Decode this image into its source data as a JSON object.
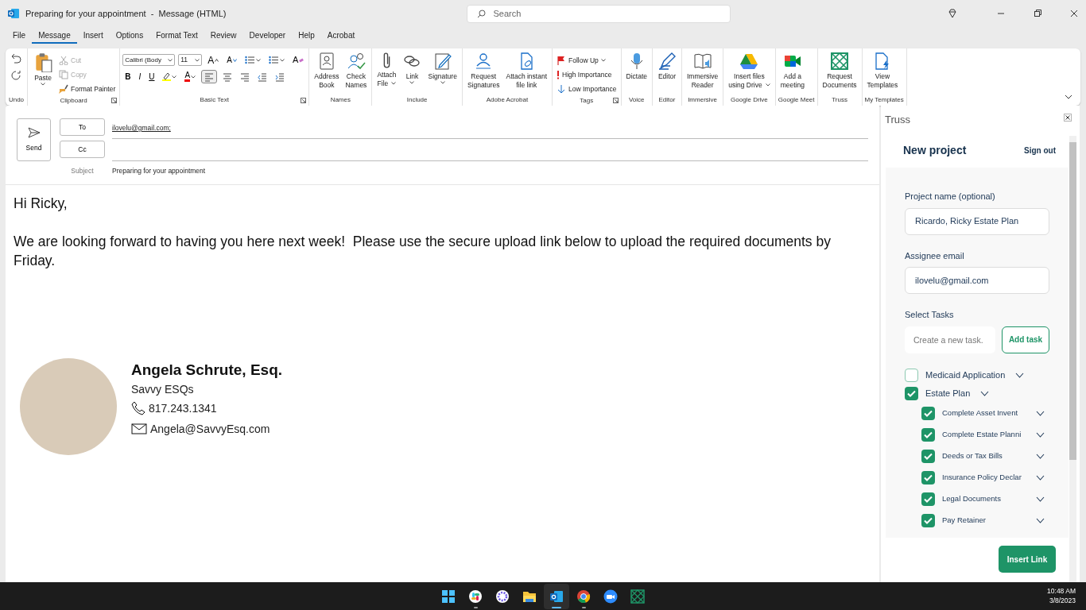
{
  "window": {
    "title": "Preparing for your appointment  -  Message (HTML)",
    "search_placeholder": "Search"
  },
  "menu_tabs": [
    {
      "label": "File",
      "selected": false
    },
    {
      "label": "Message",
      "selected": true
    },
    {
      "label": "Insert",
      "selected": false
    },
    {
      "label": "Options",
      "selected": false
    },
    {
      "label": "Format Text",
      "selected": false
    },
    {
      "label": "Review",
      "selected": false
    },
    {
      "label": "Developer",
      "selected": false
    },
    {
      "label": "Help",
      "selected": false
    },
    {
      "label": "Acrobat",
      "selected": false
    }
  ],
  "ribbon_groups": [
    {
      "label": "Undo",
      "launcher": false
    },
    {
      "label": "Clipboard",
      "launcher": true,
      "items": [
        {
          "kind": "large",
          "lines": [
            "Paste"
          ],
          "dropdown": true,
          "disabled": false
        },
        {
          "kind": "small",
          "lines": [
            "Cut"
          ],
          "dropdown": false,
          "disabled": true
        },
        {
          "kind": "small",
          "lines": [
            "Copy"
          ],
          "dropdown": false,
          "disabled": true
        },
        {
          "kind": "small",
          "lines": [
            "Format Painter"
          ],
          "dropdown": false,
          "disabled": false
        }
      ]
    },
    {
      "label": "Basic Text",
      "launcher": true,
      "items": [
        {
          "kind": "basic_text"
        }
      ]
    },
    {
      "label": "Names",
      "launcher": false,
      "items": [
        {
          "kind": "large",
          "lines": [
            "Address",
            "Book"
          ],
          "dropdown": false,
          "disabled": false
        },
        {
          "kind": "large",
          "lines": [
            "Check",
            "Names"
          ],
          "dropdown": false,
          "disabled": false
        }
      ]
    },
    {
      "label": "Include",
      "launcher": false,
      "items": [
        {
          "kind": "large",
          "lines": [
            "Attach",
            "File"
          ],
          "dropdown": true,
          "disabled": false
        },
        {
          "kind": "large",
          "lines": [
            "Link"
          ],
          "dropdown": true,
          "disabled": false
        },
        {
          "kind": "large",
          "lines": [
            "Signature"
          ],
          "dropdown": true,
          "disabled": false
        }
      ]
    },
    {
      "label": "Adobe Acrobat",
      "launcher": false,
      "items": [
        {
          "kind": "large",
          "lines": [
            "Request",
            "Signatures"
          ],
          "dropdown": false,
          "disabled": false
        },
        {
          "kind": "large",
          "lines": [
            "Attach instant",
            "file link"
          ],
          "dropdown": false,
          "disabled": false
        }
      ]
    },
    {
      "label": "Tags",
      "launcher": true,
      "items": [
        {
          "kind": "small",
          "lines": [
            "Follow Up"
          ],
          "dropdown": true,
          "disabled": false
        },
        {
          "kind": "small",
          "lines": [
            "High Importance"
          ],
          "dropdown": false,
          "disabled": false
        },
        {
          "kind": "small",
          "lines": [
            "Low Importance"
          ],
          "dropdown": false,
          "disabled": false
        }
      ]
    },
    {
      "label": "Voice",
      "launcher": false,
      "items": [
        {
          "kind": "large",
          "lines": [
            "Dictate"
          ],
          "dropdown": false,
          "disabled": false
        }
      ]
    },
    {
      "label": "Editor",
      "launcher": false,
      "items": [
        {
          "kind": "large",
          "lines": [
            "Editor"
          ],
          "dropdown": false,
          "disabled": false
        }
      ]
    },
    {
      "label": "Immersive",
      "launcher": false,
      "items": [
        {
          "kind": "large",
          "lines": [
            "Immersive",
            "Reader"
          ],
          "dropdown": false,
          "disabled": false
        }
      ]
    },
    {
      "label": "Google Drive",
      "launcher": false,
      "items": [
        {
          "kind": "large",
          "lines": [
            "Insert files",
            "using Drive"
          ],
          "dropdown": true,
          "disabled": false
        }
      ]
    },
    {
      "label": "Google Meet",
      "launcher": false,
      "items": [
        {
          "kind": "large",
          "lines": [
            "Add a",
            "meeting"
          ],
          "dropdown": false,
          "disabled": false
        }
      ]
    },
    {
      "label": "Truss",
      "launcher": false,
      "items": [
        {
          "kind": "large",
          "lines": [
            "Request",
            "Documents"
          ],
          "dropdown": false,
          "disabled": false
        }
      ]
    },
    {
      "label": "My Templates",
      "launcher": false,
      "items": [
        {
          "kind": "large",
          "lines": [
            "View",
            "Templates"
          ],
          "dropdown": false,
          "disabled": false
        }
      ]
    }
  ],
  "basic_text": {
    "font": "Calibri (Body",
    "size": "11",
    "text_buttons": [
      {
        "label": "A",
        "kind": "grow"
      },
      {
        "label": "A",
        "kind": "shrink"
      },
      {
        "label": "A",
        "kind": "clear"
      },
      {
        "label": "B",
        "kind": "bold"
      },
      {
        "label": "I",
        "kind": "italic"
      },
      {
        "label": "U",
        "kind": "underline"
      },
      {
        "label": "A",
        "kind": "font_color"
      }
    ],
    "alignment": [
      {
        "selected": true
      },
      {
        "selected": false
      },
      {
        "selected": false
      }
    ]
  },
  "compose": {
    "send": "Send",
    "to_button": "To",
    "to_value": "ilovelu@gmail.com;",
    "cc_button": "Cc",
    "subject_label": "Subject",
    "subject_value": "Preparing for your appointment",
    "body": [
      "Hi Ricky,",
      "We are looking forward to having you here next week!  Please use the secure upload link below to upload the required documents by Friday."
    ],
    "signature": {
      "name": "Angela Schrute, Esq.",
      "company": "Savvy ESQs",
      "phone": "817.243.1341",
      "email": "Angela@SavvyEsq.com"
    }
  },
  "truss_pane": {
    "title": "Truss",
    "heading": "New project",
    "sign_out": "Sign out",
    "project_label": "Project name (optional)",
    "project_value": "Ricardo, Ricky Estate Plan",
    "assignee_label": "Assignee email",
    "assignee_value": "ilovelu@gmail.com",
    "tasks_label": "Select Tasks",
    "new_task_placeholder": "Create a new task.",
    "add_task": "Add task",
    "tasks": [
      {
        "label": "Medicaid Application",
        "checked": false
      },
      {
        "label": "Estate Plan",
        "checked": true,
        "children": [
          {
            "label": "Complete Asset Invent",
            "checked": true
          },
          {
            "label": "Complete Estate Planni",
            "checked": true
          },
          {
            "label": "Deeds or Tax Bills",
            "checked": true
          },
          {
            "label": "Insurance Policy Declar",
            "checked": true
          },
          {
            "label": "Legal Documents",
            "checked": true
          },
          {
            "label": "Pay Retainer",
            "checked": true
          }
        ]
      }
    ],
    "insert_link": "Insert Link"
  },
  "taskbar": {
    "apps": [
      {
        "running": false,
        "selected": false
      },
      {
        "running": true,
        "selected": false
      },
      {
        "running": false,
        "selected": false
      },
      {
        "running": false,
        "selected": false
      },
      {
        "running": true,
        "selected": true
      },
      {
        "running": true,
        "selected": false
      },
      {
        "running": false,
        "selected": false
      },
      {
        "running": false,
        "selected": false
      }
    ],
    "time": "10:48 AM",
    "date": "3/8/2023"
  }
}
